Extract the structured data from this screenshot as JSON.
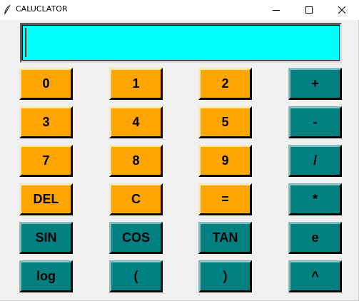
{
  "window": {
    "title": "CALUCLATOR",
    "icon": "feather-icon",
    "controls": {
      "minimize_icon": "minimize-icon",
      "maximize_icon": "maximize-icon",
      "close_icon": "close-icon"
    }
  },
  "display": {
    "value": "",
    "background_color": "#00ffff"
  },
  "colors": {
    "orange": "#ffa500",
    "teal": "#008080"
  },
  "keypad": {
    "row1": [
      "0",
      "1",
      "2",
      "+"
    ],
    "row2": [
      "3",
      "4",
      "5",
      "-"
    ],
    "row3": [
      "7",
      "8",
      "9",
      "/"
    ],
    "row4": [
      "DEL",
      "C",
      "=",
      "*"
    ],
    "row5": [
      "SIN",
      "COS",
      "TAN",
      "e"
    ],
    "row6": [
      "log",
      "(",
      ")",
      "^"
    ]
  }
}
